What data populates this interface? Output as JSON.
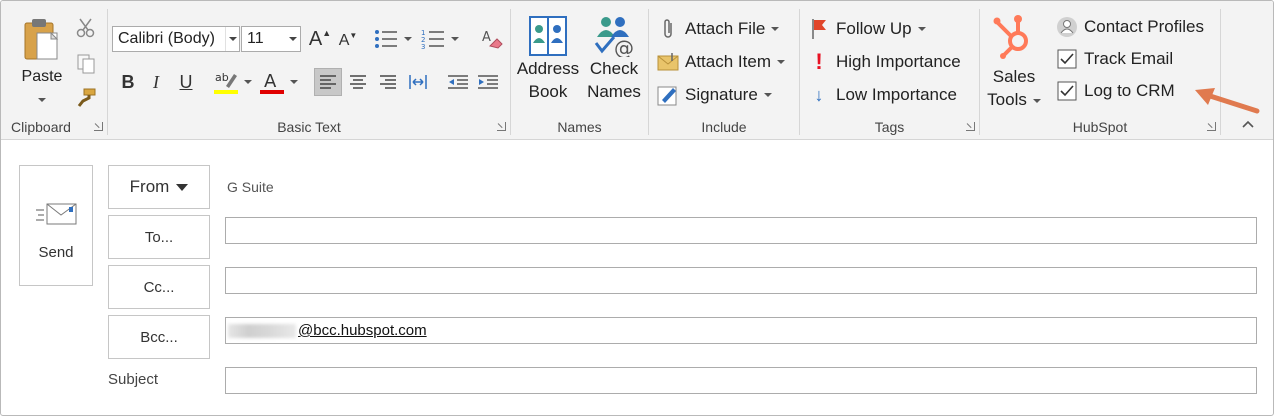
{
  "ribbon": {
    "clipboard": {
      "group_label": "Clipboard",
      "paste_label": "Paste"
    },
    "basic_text": {
      "group_label": "Basic Text",
      "font_name": "Calibri (Body)",
      "font_size": "11",
      "bold": "B",
      "italic": "I",
      "underline": "U",
      "grow_font": "A",
      "shrink_font": "A",
      "font_color_letter": "A",
      "highlight_color": "#ffff00",
      "font_color": "#e00000"
    },
    "names": {
      "group_label": "Names",
      "address_book_line1": "Address",
      "address_book_line2": "Book",
      "check_names_line1": "Check",
      "check_names_line2": "Names"
    },
    "include": {
      "group_label": "Include",
      "attach_file": "Attach File",
      "attach_item": "Attach Item",
      "signature": "Signature"
    },
    "tags": {
      "group_label": "Tags",
      "follow_up": "Follow Up",
      "high_importance": "High Importance",
      "low_importance": "Low Importance",
      "flag_color": "#e0452a",
      "high_color": "#e81123",
      "low_color": "#2f6fbf"
    },
    "hubspot": {
      "group_label": "HubSpot",
      "sales_tools_line1": "Sales",
      "sales_tools_line2": "Tools",
      "contact_profiles": "Contact Profiles",
      "track_email": "Track Email",
      "track_email_checked": true,
      "log_to_crm": "Log to CRM",
      "log_to_crm_checked": true,
      "brand_color": "#ff7a59",
      "annotation_arrow_color": "#e07a4f"
    }
  },
  "compose": {
    "send_label": "Send",
    "from_label": "From",
    "from_value": "G Suite",
    "to_label": "To...",
    "cc_label": "Cc...",
    "bcc_label": "Bcc...",
    "to_value": "",
    "cc_value": "",
    "bcc_value": "@bcc.hubspot.com",
    "subject_label": "Subject",
    "subject_value": ""
  }
}
